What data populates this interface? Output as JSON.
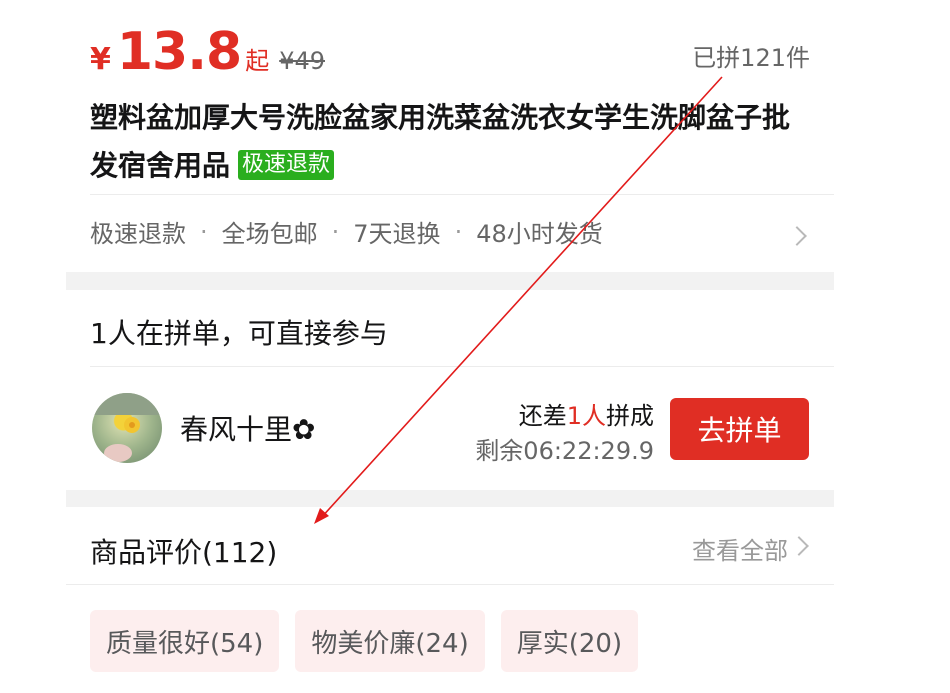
{
  "price": {
    "currency": "¥",
    "amount": "13.8",
    "suffix": "起",
    "original": "¥49",
    "sold": "已拼121件"
  },
  "product": {
    "title": "塑料盆加厚大号洗脸盆家用洗菜盆洗衣女学生洗脚盆子批发宿舍用品",
    "tag": "极速退款"
  },
  "services": [
    "极速退款",
    "全场包邮",
    "7天退换",
    "48小时发货"
  ],
  "service_separator": "·",
  "group": {
    "header": "1人在拼单，可直接参与",
    "user_name": "春风十里✿",
    "need_prefix": "还差",
    "need_count": "1人",
    "need_suffix": "拼成",
    "remaining": "剩余06:22:29.9",
    "join_button": "去拼单"
  },
  "reviews": {
    "title": "商品评价(112)",
    "view_all": "查看全部",
    "chips": [
      "质量很好(54)",
      "物美价廉(24)",
      "厚实(20)"
    ]
  },
  "colors": {
    "accent": "#e02e24",
    "tag_green": "#2aae1e",
    "chip_bg": "#fdeeee"
  }
}
